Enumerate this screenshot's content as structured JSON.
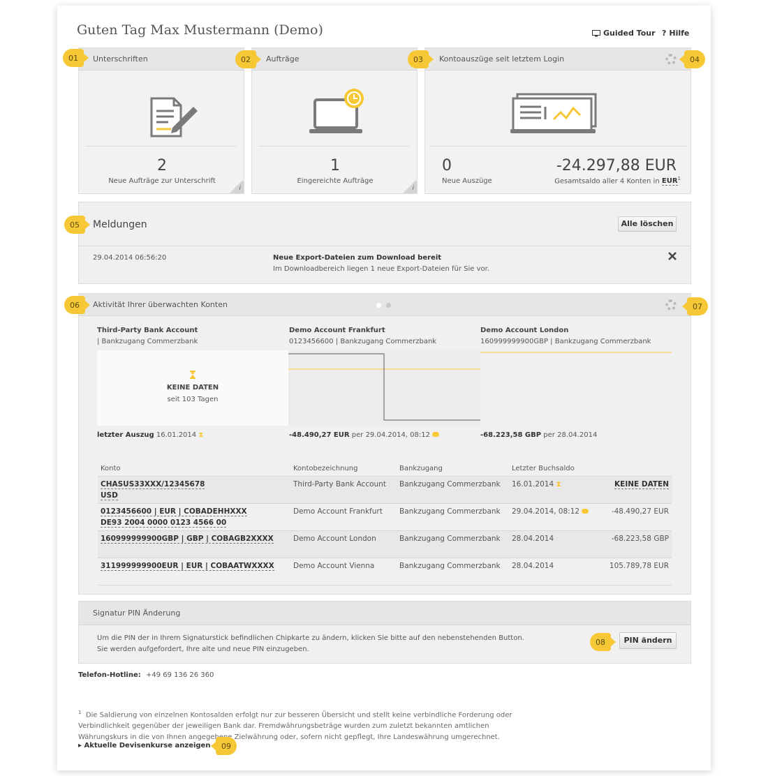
{
  "header": {
    "greeting": "Guten Tag Max Mustermann (Demo)",
    "guided_tour": "Guided Tour",
    "help": "Hilfe",
    "help_prefix": "?"
  },
  "markers": [
    "01",
    "02",
    "03",
    "04",
    "05",
    "06",
    "07",
    "08",
    "09"
  ],
  "tiles": {
    "signatures": {
      "title": "Unterschriften",
      "count": "2",
      "caption": "Neue Aufträge zur Unterschrift",
      "info": "i"
    },
    "orders": {
      "title": "Aufträge",
      "count": "1",
      "caption": "Eingereichte Aufträge",
      "info": "i"
    },
    "statements": {
      "title": "Kontoauszüge seit letztem Login",
      "count": "0",
      "caption": "Neue Auszüge",
      "balance": "-24.297,88 EUR",
      "balance_caption": "Gesamtsaldo aller 4 Konten in",
      "currency": "EUR",
      "footnote_ref": "1"
    }
  },
  "messages": {
    "title": "Meldungen",
    "clear_all": "Alle löschen",
    "items": [
      {
        "timestamp": "29.04.2014 06:56:20",
        "headline": "Neue Export-Dateien zum Download bereit",
        "text": "Im Downloadbereich liegen 1 neue Export-Dateien für Sie vor."
      }
    ]
  },
  "activity": {
    "title": "Aktivität Ihrer überwachten Konten",
    "accounts": [
      {
        "name": "Third-Party Bank Account",
        "sub": "| Bankzugang Commerzbank",
        "nodata": "KEINE DATEN",
        "since": "seit 103 Tagen",
        "footer_label": "letzter Auszug",
        "footer_value": "16.01.2014"
      },
      {
        "name": "Demo Account Frankfurt",
        "sub": "0123456600 | Bankzugang Commerzbank",
        "footer_label": "-48.490,27 EUR",
        "footer_value": "per 29.04.2014, 08:12"
      },
      {
        "name": "Demo Account London",
        "sub": "160999999900GBP | Bankzugang Commerzbank",
        "footer_label": "-68.223,58 GBP",
        "footer_value": "per 28.04.2014"
      }
    ],
    "table": {
      "headers": [
        "Konto",
        "Kontobezeichnung",
        "Bankzugang",
        "Letzter Buchsaldo"
      ],
      "rows": [
        {
          "konto1": "CHASUS33XXX/12345678",
          "konto2": "USD",
          "bez": "Third-Party Bank Account",
          "bank": "Bankzugang Commerzbank",
          "date": "16.01.2014",
          "saldo": "KEINE DATEN"
        },
        {
          "konto1": "0123456600 | EUR | COBADEHHXXX",
          "konto2": "DE93 2004 0000 0123 4566 00",
          "bez": "Demo Account Frankfurt",
          "bank": "Bankzugang Commerzbank",
          "date": "29.04.2014, 08:12",
          "saldo": "-48.490,27 EUR"
        },
        {
          "konto1": "160999999900GBP | GBP | COBAGB2XXXX",
          "konto2": "",
          "bez": "Demo Account London",
          "bank": "Bankzugang Commerzbank",
          "date": "28.04.2014",
          "saldo": "-68.223,58 GBP"
        },
        {
          "konto1": "311999999900EUR | EUR | COBAATWXXXX",
          "konto2": "",
          "bez": "Demo Account Vienna",
          "bank": "Bankzugang Commerzbank",
          "date": "28.04.2014",
          "saldo": "105.789,78 EUR"
        }
      ]
    }
  },
  "pin": {
    "title": "Signatur PIN Änderung",
    "line1": "Um die PIN der in Ihrem Signaturstick befindlichen Chipkarte zu ändern, klicken Sie bitte auf den nebenstehenden Button.",
    "line2": "Sie werden aufgefordert, Ihre alte und neue PIN einzugeben.",
    "button": "PIN ändern"
  },
  "hotline": {
    "label": "Telefon-Hotline:",
    "number": "+49 69 136 26 360"
  },
  "footer": {
    "note_ref": "1",
    "line1": "Die Saldierung von einzelnen Kontosalden erfolgt nur zur besseren Übersicht und stellt keine verbindliche Forderung oder",
    "line2": "Verbindlichkeit gegenüber der jeweiligen Bank dar. Fremdwährungsbeträge wurden zum zuletzt bekannten amtlichen",
    "line3": "Währungskurs in die von Ihnen angegebene Zielwährung oder, sofern nicht gepflegt, Ihre Landeswährung umgerechnet.",
    "link": "Aktuelle Devisenkurse anzeigen"
  },
  "colors": {
    "accent": "#f7c836",
    "panel": "#f0f0f0",
    "header": "#e6e6e6"
  }
}
